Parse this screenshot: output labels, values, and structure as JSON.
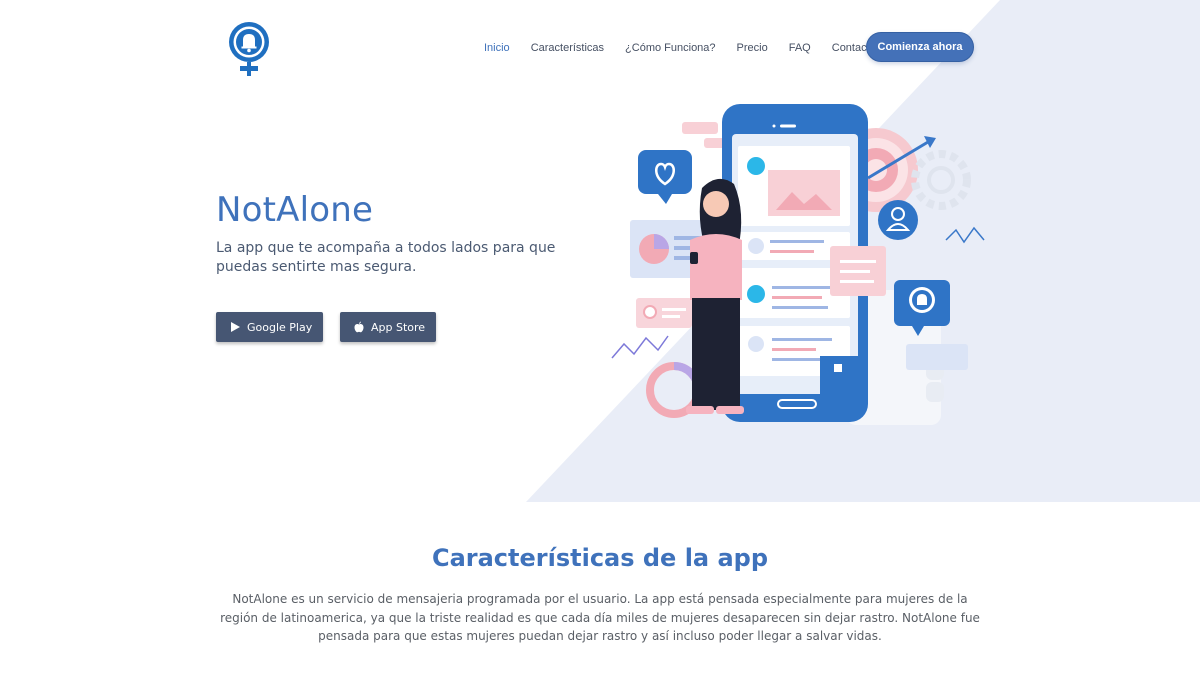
{
  "brand": {
    "logo_icon": "bell-female-symbol-icon",
    "colors": {
      "primary": "#3f72bb",
      "button_dark": "#465673",
      "bg_accent": "#e9edf7"
    }
  },
  "nav": {
    "items": [
      {
        "label": "Inicio",
        "active": true
      },
      {
        "label": "Características",
        "active": false
      },
      {
        "label": "¿Cómo Funciona?",
        "active": false
      },
      {
        "label": "Precio",
        "active": false
      },
      {
        "label": "FAQ",
        "active": false
      },
      {
        "label": "Contacto",
        "active": false
      }
    ],
    "cta_label": "Comienza ahora"
  },
  "hero": {
    "title": "NotAlone",
    "subtitle": "La app que te acompaña a todos lados para que puedas sentirte mas segura.",
    "buttons": {
      "google_play": {
        "label": "Google Play",
        "icon": "play-triangle-icon"
      },
      "app_store": {
        "label": "App Store",
        "icon": "apple-icon"
      }
    },
    "illustration": "woman-with-phone-illustration"
  },
  "features": {
    "title": "Características de la app",
    "text": "NotAlone es un servicio de mensajeria programada por el usuario. La app está pensada especialmente para mujeres de la región de latinoamerica, ya que la triste realidad es que cada día miles de mujeres desaparecen sin dejar rastro. NotAlone fue pensada para que estas mujeres puedan dejar rastro y así incluso poder llegar a salvar vidas."
  }
}
